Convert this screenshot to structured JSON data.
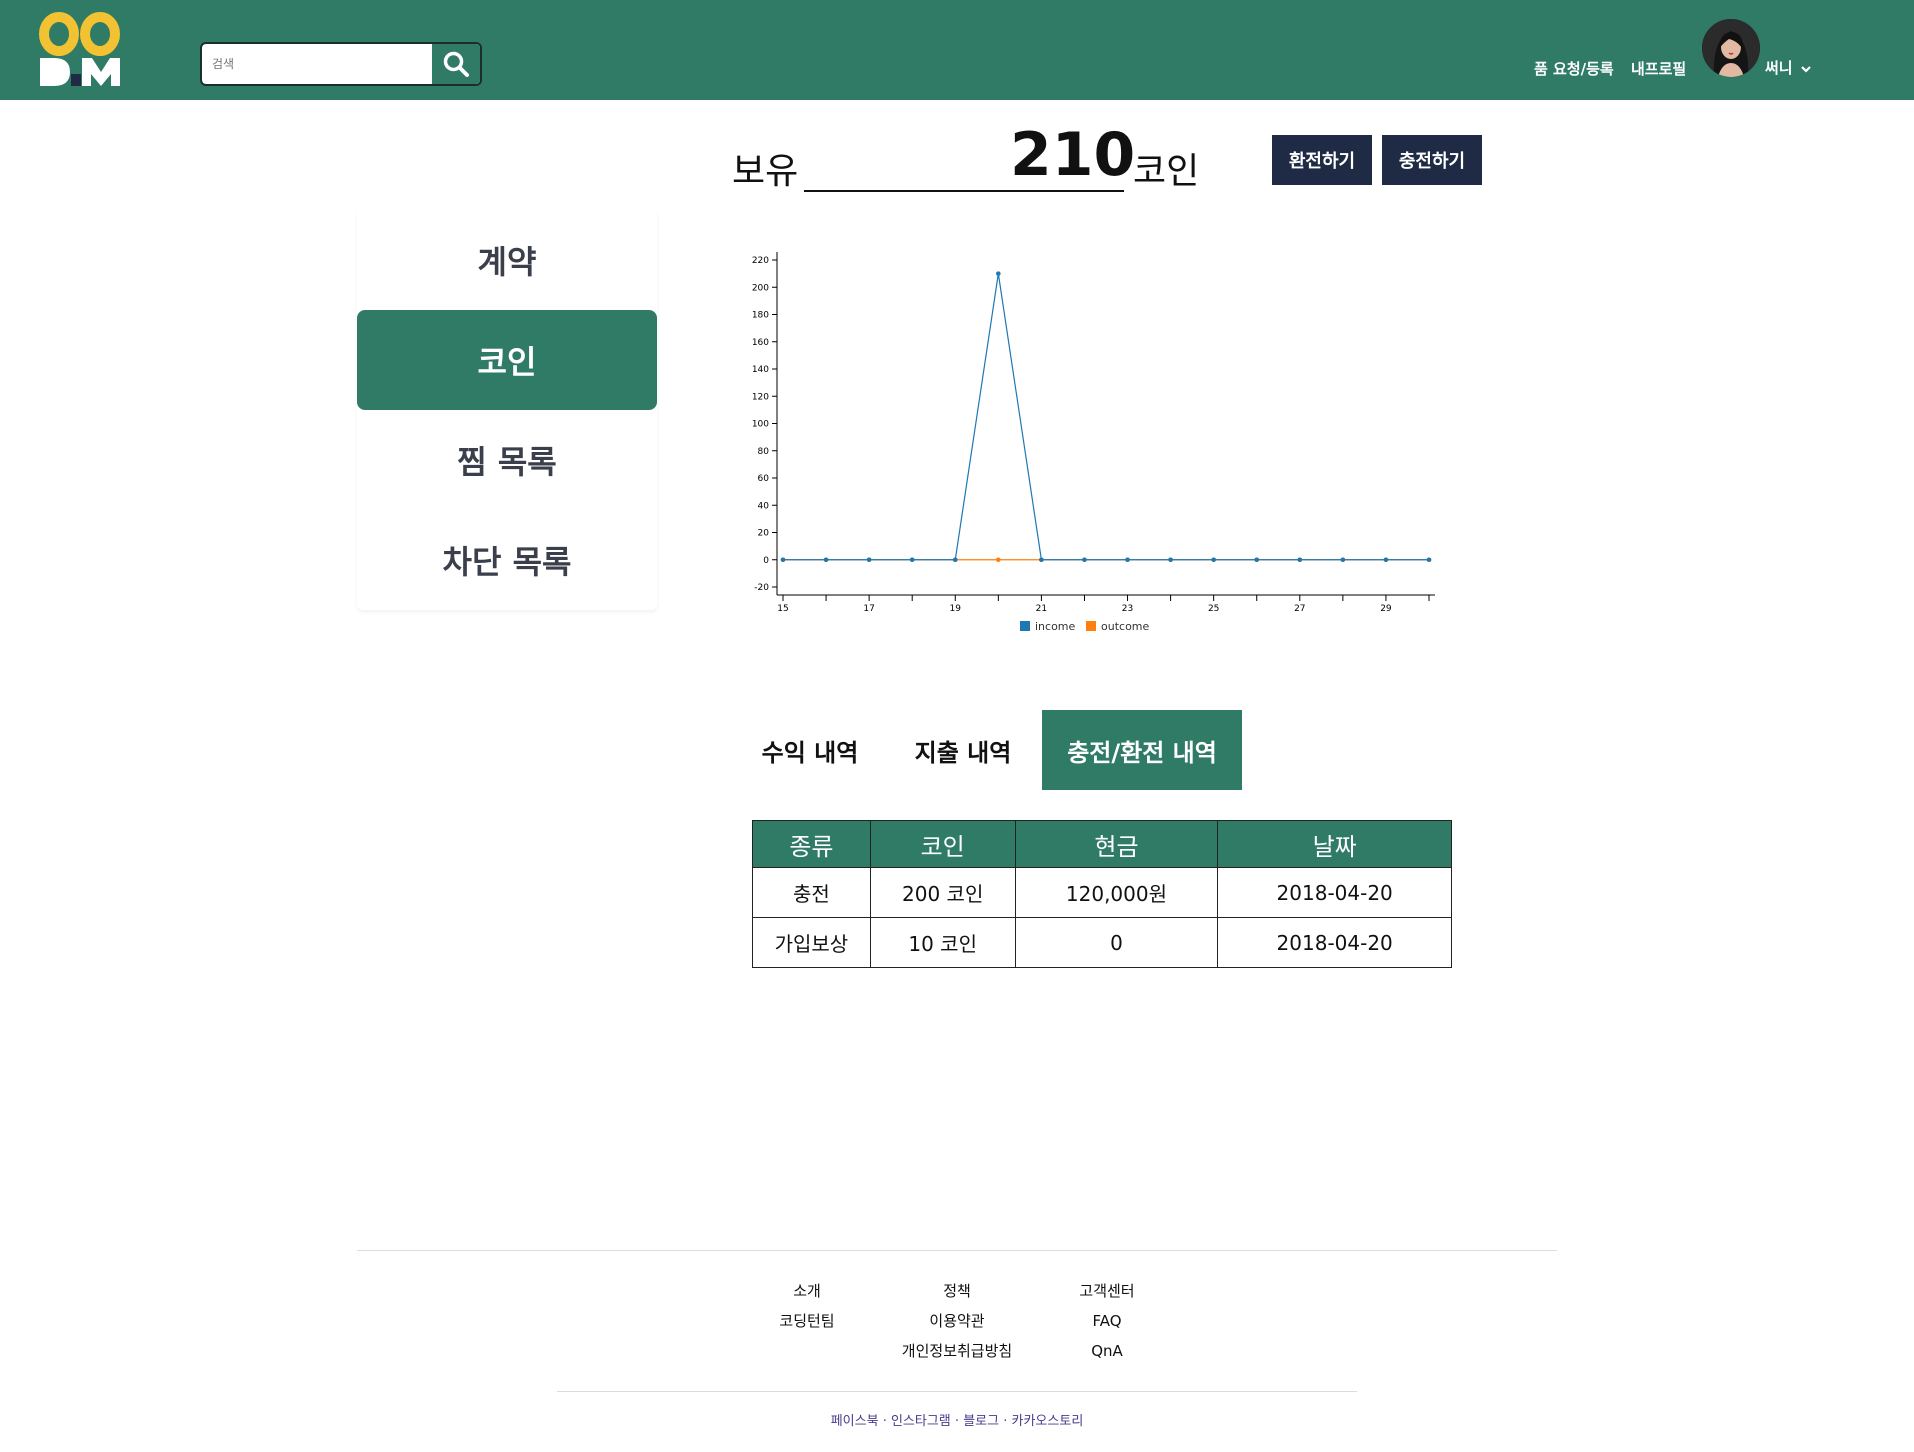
{
  "header": {
    "search_placeholder": "검색",
    "nav": {
      "request_register": "품 요청/등록",
      "my_profile": "내프로필"
    },
    "user_name": "써니",
    "brand_colors": {
      "primary": "#2f7b66",
      "logo_yellow": "#f2c232",
      "dark_button": "#1f2a44"
    }
  },
  "balance": {
    "label": "보유",
    "amount": "210",
    "unit": "코인",
    "exchange_button": "환전하기",
    "charge_button": "충전하기"
  },
  "sidebar": {
    "items": [
      {
        "label": "계약",
        "active": false
      },
      {
        "label": "코인",
        "active": true
      },
      {
        "label": "찜 목록",
        "active": false
      },
      {
        "label": "차단 목록",
        "active": false
      }
    ]
  },
  "chart_data": {
    "type": "line",
    "x": [
      15,
      16,
      17,
      18,
      19,
      20,
      21,
      22,
      23,
      24,
      25,
      26,
      27,
      28,
      29,
      30
    ],
    "x_tick_labels": [
      "15",
      "17",
      "19",
      "21",
      "23",
      "25",
      "27",
      "29"
    ],
    "y_tick_labels": [
      "-20",
      "0",
      "20",
      "40",
      "60",
      "80",
      "100",
      "120",
      "140",
      "160",
      "180",
      "200",
      "220"
    ],
    "ylim": [
      -20,
      220
    ],
    "xlim": [
      15,
      30
    ],
    "legend_position": "bottom",
    "series": [
      {
        "name": "income",
        "color": "#1f77b4",
        "values": [
          0,
          0,
          0,
          0,
          0,
          210,
          0,
          0,
          0,
          0,
          0,
          0,
          0,
          0,
          0,
          0
        ]
      },
      {
        "name": "outcome",
        "color": "#ff7f0e",
        "values": [
          0,
          0,
          0,
          0,
          0,
          0,
          0,
          0,
          0,
          0,
          0,
          0,
          0,
          0,
          0,
          0
        ]
      }
    ]
  },
  "tabs": [
    {
      "label": "수익 내역",
      "active": false
    },
    {
      "label": "지출 내역",
      "active": false
    },
    {
      "label": "충전/환전 내역",
      "active": true
    }
  ],
  "table": {
    "headers": [
      "종류",
      "코인",
      "현금",
      "날짜"
    ],
    "rows": [
      [
        "충전",
        "200 코인",
        "120,000원",
        "2018-04-20"
      ],
      [
        "가입보상",
        "10 코인",
        "0",
        "2018-04-20"
      ]
    ]
  },
  "footer": {
    "columns": [
      {
        "title": "소개",
        "links": [
          "코딩턴팀"
        ]
      },
      {
        "title": "정책",
        "links": [
          "이용약관",
          "개인정보취급방침"
        ]
      },
      {
        "title": "고객센터",
        "links": [
          "FAQ",
          "QnA"
        ]
      }
    ],
    "social": [
      "페이스북",
      "인스타그램",
      "블로그",
      "카카오스토리"
    ],
    "social_separator": "·"
  }
}
